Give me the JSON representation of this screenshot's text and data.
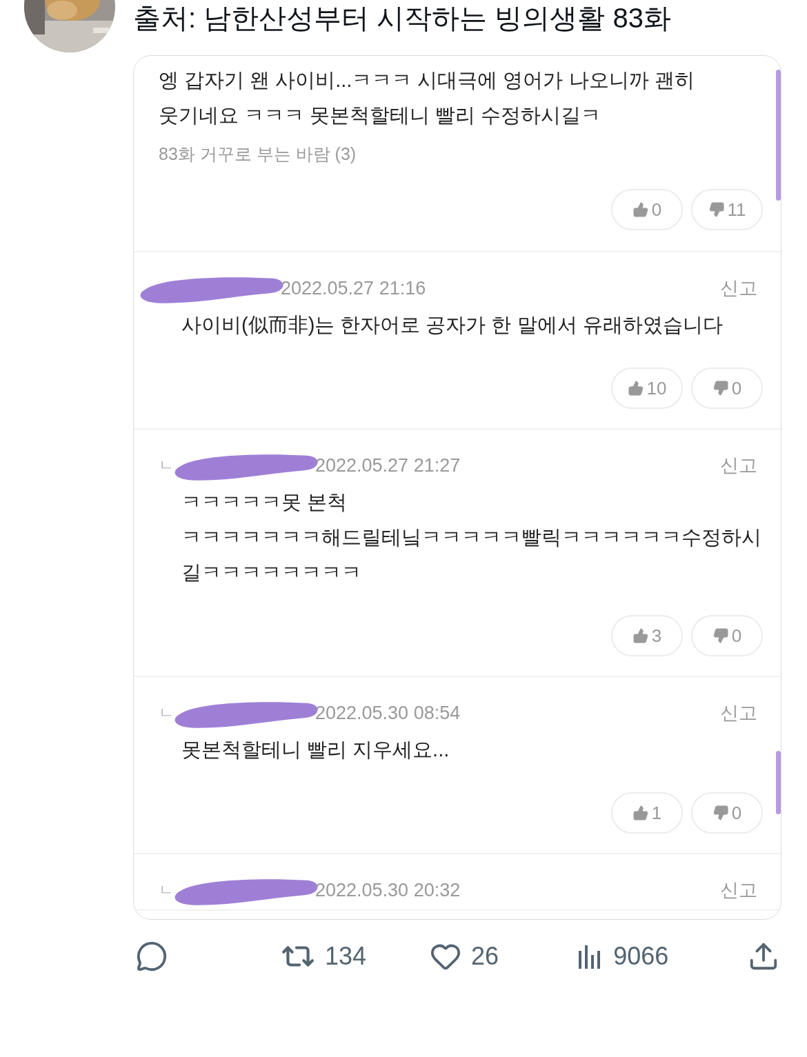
{
  "post": {
    "text": "출처: 남한산성부터 시작하는 빙의생활 83화"
  },
  "comments": [
    {
      "kind": "comment",
      "body": "엥 갑자기 왠 사이비...ㅋㅋㅋ 시대극에 영어가 나오니까 괜히\n웃기네요 ㅋㅋㅋ 못본척할테니 빨리 수정하시길ㅋ",
      "source": "83화 거꾸로 부는 바람 (3)",
      "likes": "0",
      "dislikes": "11"
    },
    {
      "kind": "reply",
      "date": "2022.05.27 21:16",
      "report": "신고",
      "body": "사이비(似而非)는 한자어로 공자가 한 말에서 유래하였습니다",
      "likes": "10",
      "dislikes": "0"
    },
    {
      "kind": "reply",
      "marker": "ㄴ",
      "date": "2022.05.27 21:27",
      "report": "신고",
      "body": "ㅋㅋㅋㅋㅋ못 본척\nㅋㅋㅋㅋㅋㅋㅋ해드릴테닠ㅋㅋㅋㅋㅋ빨릭ㅋㅋㅋㅋㅋㅋ수정하시\n길ㅋㅋㅋㅋㅋㅋㅋㅋ",
      "likes": "3",
      "dislikes": "0"
    },
    {
      "kind": "reply",
      "marker": "ㄴ",
      "date": "2022.05.30 08:54",
      "report": "신고",
      "body": "못본척할테니 빨리 지우세요...",
      "likes": "1",
      "dislikes": "0"
    },
    {
      "kind": "reply",
      "marker": "ㄴ",
      "date": "2022.05.30 20:32",
      "report": "신고"
    }
  ],
  "actions": {
    "retweets": "134",
    "likes": "26",
    "views": "9066"
  }
}
